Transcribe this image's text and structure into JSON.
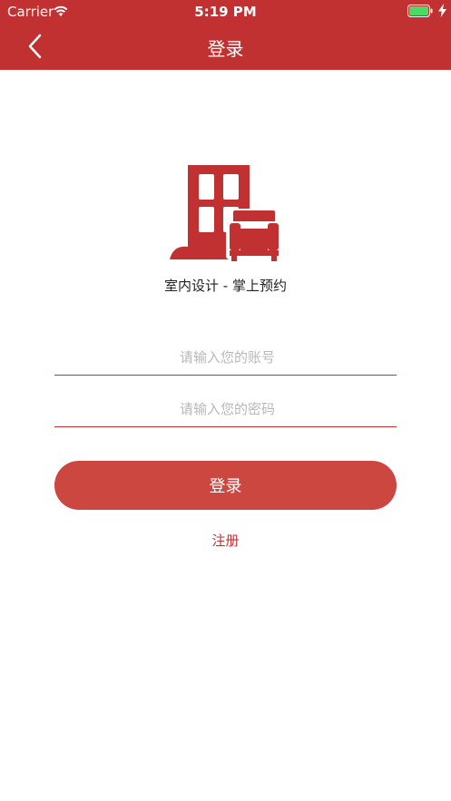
{
  "status_bar": {
    "carrier": "Carrier",
    "time": "5:19 PM",
    "battery_color": "#4cd964"
  },
  "nav": {
    "title": "登录",
    "back_icon": "chevron-left-icon"
  },
  "logo": {
    "icon": "building-sofa-icon",
    "slogan": "室内设计 - 掌上预约"
  },
  "form": {
    "account_placeholder": "请输入您的账号",
    "account_value": "",
    "password_placeholder": "请输入您的密码",
    "password_value": "",
    "login_label": "登录",
    "register_label": "注册"
  },
  "colors": {
    "primary": "#c23131",
    "button": "#cc4740"
  }
}
